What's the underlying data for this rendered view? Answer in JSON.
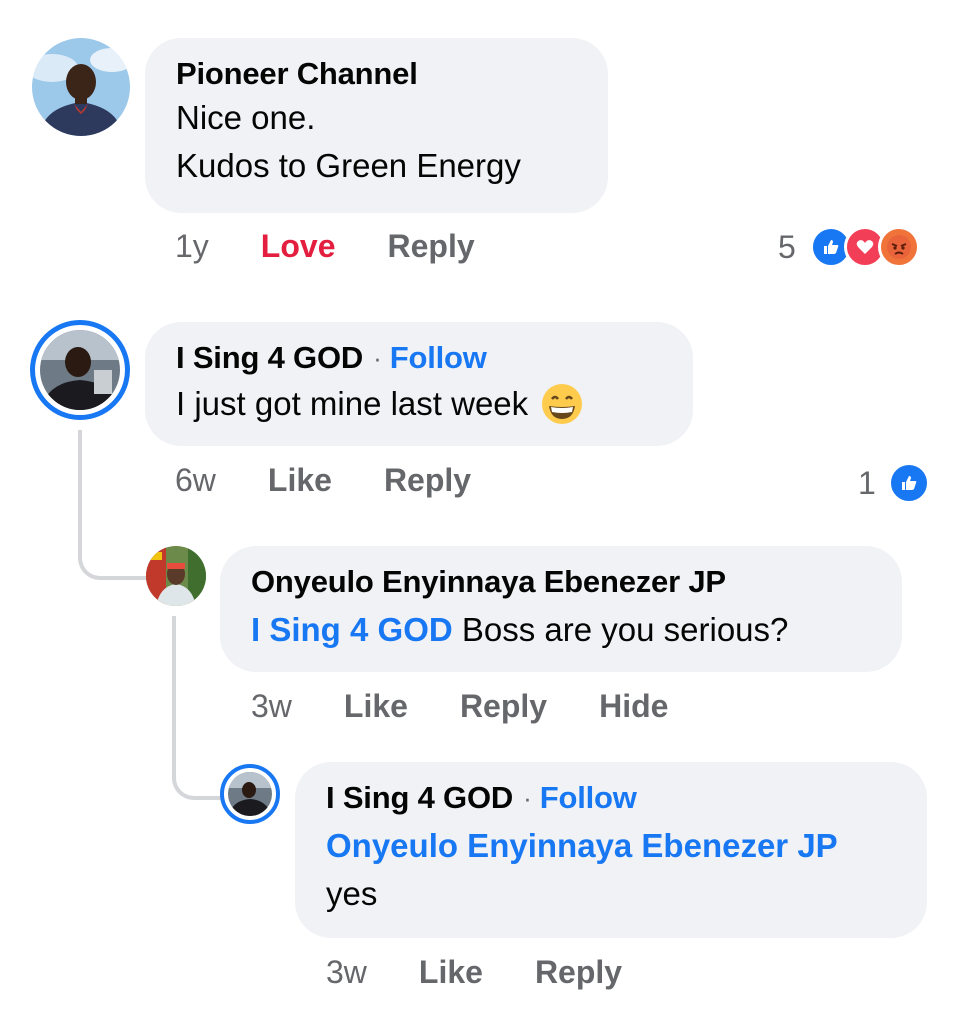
{
  "comments": [
    {
      "author": "Pioneer Channel",
      "line1": "Nice one.",
      "line2": "Kudos to Green Energy",
      "time": "1y",
      "reaction_action": "Love",
      "reply": "Reply",
      "reaction_count": "5",
      "reaction_icons": [
        "like-icon",
        "love-icon",
        "angry-icon"
      ]
    },
    {
      "author": "I Sing 4 GOD",
      "follow": "Follow",
      "text": "I just got mine last week",
      "emoji": "😁",
      "time": "6w",
      "like": "Like",
      "reply": "Reply",
      "reaction_count": "1",
      "reaction_icons": [
        "like-icon"
      ]
    },
    {
      "author": "Onyeulo Enyinnaya Ebenezer JP",
      "mention": "I Sing 4 GOD",
      "text": " Boss are you serious?",
      "time": "3w",
      "like": "Like",
      "reply": "Reply",
      "hide": "Hide"
    },
    {
      "author": "I Sing 4 GOD",
      "follow": "Follow",
      "mention": "Onyeulo Enyinnaya Ebenezer JP",
      "text": "yes",
      "time": "3w",
      "like": "Like",
      "reply": "Reply"
    }
  ],
  "colors": {
    "accent": "#1877f2",
    "love": "#e41e3f",
    "bubble": "#f0f2f5",
    "meta": "#65676b"
  }
}
